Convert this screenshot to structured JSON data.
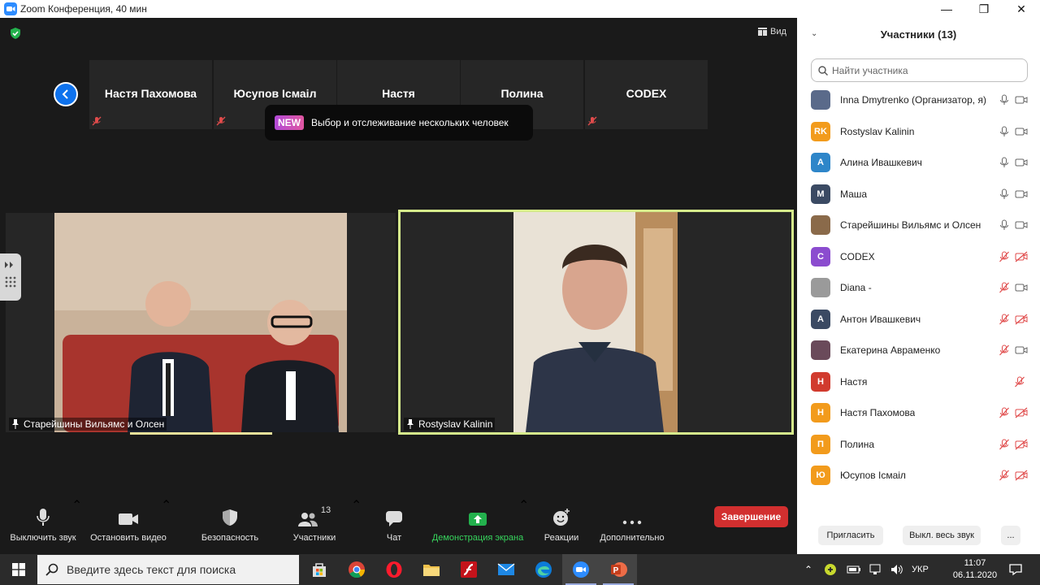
{
  "window": {
    "title": "Zoom Конференция, 40 мин",
    "minimize": "—",
    "maximize": "❐",
    "close": "✕"
  },
  "meeting": {
    "view_label": "Вид",
    "tiles": [
      {
        "name": "Настя Пахомова"
      },
      {
        "name": "Юсупов Ісмаіл"
      },
      {
        "name": "Настя"
      },
      {
        "name": "Полина"
      },
      {
        "name": "CODEX"
      }
    ],
    "tooltip": {
      "badge": "NEW",
      "text": "Выбор и отслеживание нескольких человек"
    },
    "videos": [
      {
        "label": "Старейшины Вильямс и Олсен"
      },
      {
        "label": "Rostyslav Kalinin"
      }
    ]
  },
  "toolbar": {
    "mute": "Выключить звук",
    "video": "Остановить видео",
    "security": "Безопасность",
    "participants": "Участники",
    "participants_count": "13",
    "chat": "Чат",
    "share": "Демонстрация экрана",
    "reactions": "Реакции",
    "more": "Дополнительно",
    "end": "Завершение"
  },
  "panel": {
    "title": "Участники (13)",
    "search_placeholder": "Найти участника",
    "participants": [
      {
        "name": "Inna Dmytrenko (Организатор, я)",
        "avatar": "",
        "color": "#5a6a8a",
        "mic": "on",
        "cam": "on"
      },
      {
        "name": "Rostyslav Kalinin",
        "avatar": "RK",
        "color": "#f29b1c",
        "mic": "on",
        "cam": "on"
      },
      {
        "name": "Алина Ивашкевич",
        "avatar": "А",
        "color": "#2e86c9",
        "mic": "on",
        "cam": "on"
      },
      {
        "name": "Маша",
        "avatar": "М",
        "color": "#3b4a63",
        "mic": "on",
        "cam": "on"
      },
      {
        "name": "Старейшины Вильямс и Олсен",
        "avatar": "",
        "color": "#8a6a4a",
        "mic": "on",
        "cam": "on"
      },
      {
        "name": "CODEX",
        "avatar": "C",
        "color": "#8b4ccf",
        "mic": "off",
        "cam": "off"
      },
      {
        "name": "Diana -",
        "avatar": "",
        "color": "#9a9a9a",
        "mic": "off",
        "cam": "on"
      },
      {
        "name": "Антон Ивашкевич",
        "avatar": "А",
        "color": "#3b4a63",
        "mic": "off",
        "cam": "off"
      },
      {
        "name": "Екатерина Авраменко",
        "avatar": "",
        "color": "#6a4a5a",
        "mic": "off",
        "cam": "on"
      },
      {
        "name": "Настя",
        "avatar": "Н",
        "color": "#d13b2e",
        "mic": "off",
        "cam": "none"
      },
      {
        "name": "Настя Пахомова",
        "avatar": "Н",
        "color": "#f29b1c",
        "mic": "off",
        "cam": "off"
      },
      {
        "name": "Полина",
        "avatar": "П",
        "color": "#f29b1c",
        "mic": "off",
        "cam": "off"
      },
      {
        "name": "Юсупов Ісмаіл",
        "avatar": "Ю",
        "color": "#f29b1c",
        "mic": "off",
        "cam": "off"
      }
    ],
    "invite": "Пригласить",
    "mute_all": "Выкл. весь звук",
    "more": "..."
  },
  "taskbar": {
    "search_placeholder": "Введите здесь текст для поиска",
    "language": "УКР",
    "time": "11:07",
    "date": "06.11.2020"
  }
}
